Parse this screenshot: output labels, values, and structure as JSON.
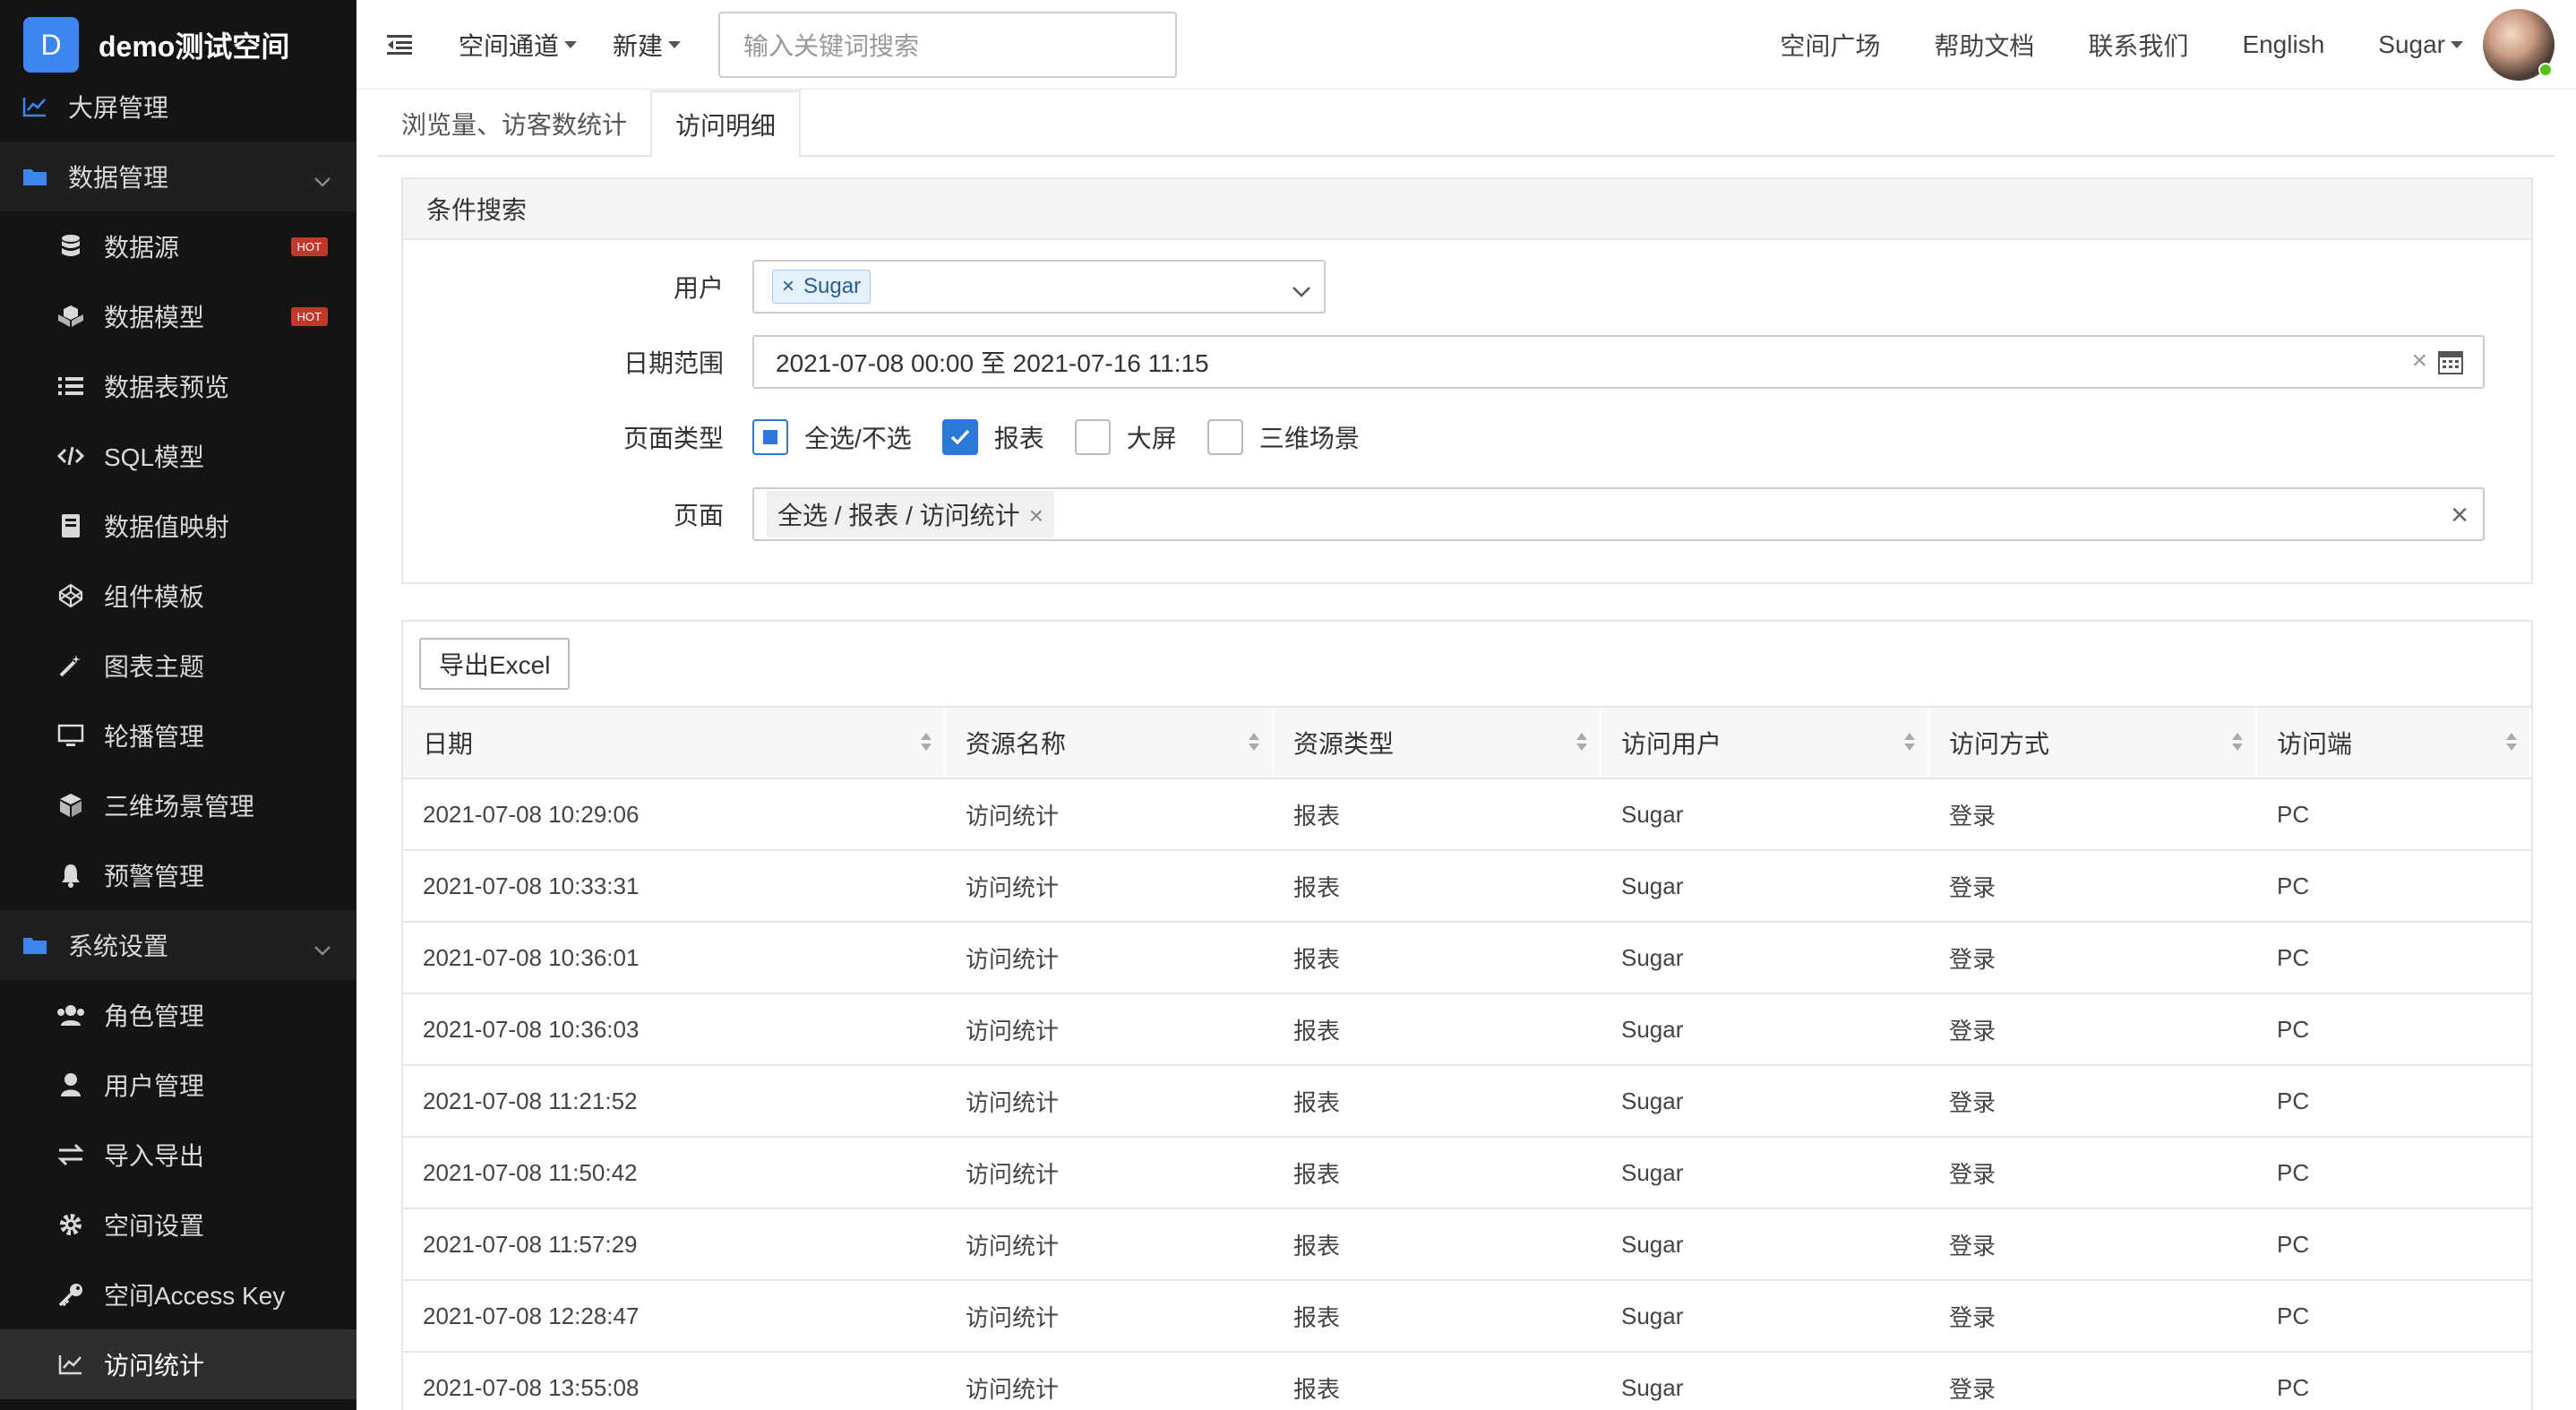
{
  "brand": {
    "logo_letter": "D",
    "name": "demo测试空间"
  },
  "sidebar": {
    "items": [
      {
        "label": "大屏管理",
        "icon": "chart-line-icon",
        "kind": "top"
      },
      {
        "label": "数据管理",
        "icon": "folder-icon",
        "kind": "group"
      },
      {
        "label": "数据源",
        "icon": "database-icon",
        "kind": "sub",
        "badge": "HOT"
      },
      {
        "label": "数据模型",
        "icon": "cubes-icon",
        "kind": "sub",
        "badge": "HOT"
      },
      {
        "label": "数据表预览",
        "icon": "list-icon",
        "kind": "sub"
      },
      {
        "label": "SQL模型",
        "icon": "code-icon",
        "kind": "sub"
      },
      {
        "label": "数据值映射",
        "icon": "book-icon",
        "kind": "sub"
      },
      {
        "label": "组件模板",
        "icon": "codepen-icon",
        "kind": "sub"
      },
      {
        "label": "图表主题",
        "icon": "magic-wand-icon",
        "kind": "sub"
      },
      {
        "label": "轮播管理",
        "icon": "monitor-icon",
        "kind": "sub"
      },
      {
        "label": "三维场景管理",
        "icon": "cube-icon",
        "kind": "sub"
      },
      {
        "label": "预警管理",
        "icon": "bell-icon",
        "kind": "sub"
      },
      {
        "label": "系统设置",
        "icon": "folder-icon",
        "kind": "group"
      },
      {
        "label": "角色管理",
        "icon": "users-icon",
        "kind": "sub"
      },
      {
        "label": "用户管理",
        "icon": "user-icon",
        "kind": "sub"
      },
      {
        "label": "导入导出",
        "icon": "exchange-icon",
        "kind": "sub"
      },
      {
        "label": "空间设置",
        "icon": "gear-icon",
        "kind": "sub"
      },
      {
        "label": "空间Access Key",
        "icon": "key-icon",
        "kind": "sub"
      },
      {
        "label": "访问统计",
        "icon": "chart-line-icon",
        "kind": "sub",
        "active": true
      }
    ]
  },
  "header": {
    "menu1": "空间通道",
    "menu2": "新建",
    "search_placeholder": "输入关键词搜索",
    "links": [
      "空间广场",
      "帮助文档",
      "联系我们",
      "English"
    ],
    "user": "Sugar"
  },
  "tabs": [
    "浏览量、访客数统计",
    "访问明细"
  ],
  "filters": {
    "title": "条件搜索",
    "user_label": "用户",
    "user_tag": "Sugar",
    "date_label": "日期范围",
    "date_value": "2021-07-08 00:00 至 2021-07-16 11:15",
    "pagetype_label": "页面类型",
    "pagetype_options": [
      "全选/不选",
      "报表",
      "大屏",
      "三维场景"
    ],
    "page_label": "页面",
    "page_chip": "全选 / 报表 / 访问统计"
  },
  "table": {
    "export_label": "导出Excel",
    "columns": [
      "日期",
      "资源名称",
      "资源类型",
      "访问用户",
      "访问方式",
      "访问端"
    ],
    "rows": [
      [
        "2021-07-08 10:29:06",
        "访问统计",
        "报表",
        "Sugar",
        "登录",
        "PC"
      ],
      [
        "2021-07-08 10:33:31",
        "访问统计",
        "报表",
        "Sugar",
        "登录",
        "PC"
      ],
      [
        "2021-07-08 10:36:01",
        "访问统计",
        "报表",
        "Sugar",
        "登录",
        "PC"
      ],
      [
        "2021-07-08 10:36:03",
        "访问统计",
        "报表",
        "Sugar",
        "登录",
        "PC"
      ],
      [
        "2021-07-08 11:21:52",
        "访问统计",
        "报表",
        "Sugar",
        "登录",
        "PC"
      ],
      [
        "2021-07-08 11:50:42",
        "访问统计",
        "报表",
        "Sugar",
        "登录",
        "PC"
      ],
      [
        "2021-07-08 11:57:29",
        "访问统计",
        "报表",
        "Sugar",
        "登录",
        "PC"
      ],
      [
        "2021-07-08 12:28:47",
        "访问统计",
        "报表",
        "Sugar",
        "登录",
        "PC"
      ],
      [
        "2021-07-08 13:55:08",
        "访问统计",
        "报表",
        "Sugar",
        "登录",
        "PC"
      ]
    ]
  },
  "colors": {
    "accent": "#3d85f0",
    "sidebar_bg": "#141414",
    "hot_badge": "#c0392b"
  }
}
